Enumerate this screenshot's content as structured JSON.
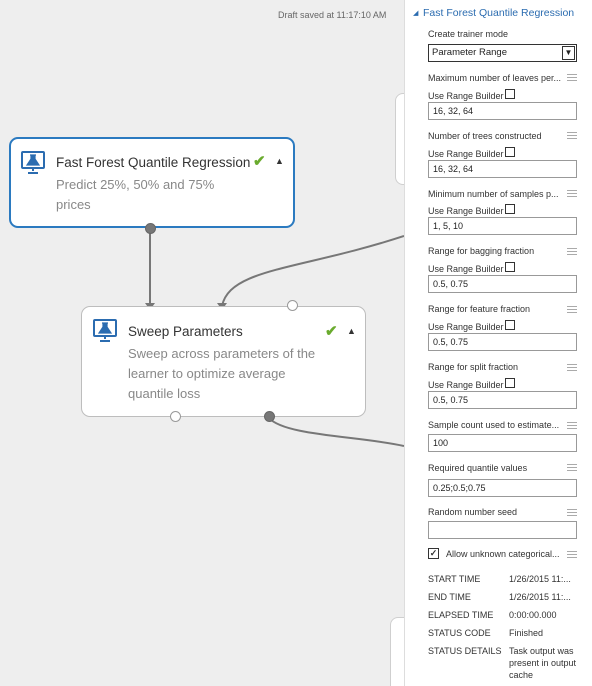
{
  "canvas": {
    "draft_status": "Draft saved at 11:17:10 AM"
  },
  "modules": [
    {
      "title": "Fast Forest Quantile Regression",
      "description": "Predict 25%, 50% and 75% prices",
      "icon": "flask-monitor-icon",
      "status": "check-icon",
      "selected": true
    },
    {
      "title": "Sweep Parameters",
      "description": "Sweep across parameters of the learner to optimize average quantile loss",
      "icon": "flask-monitor-icon",
      "status": "check-icon",
      "selected": false
    }
  ],
  "panel": {
    "title": "Fast Forest Quantile Regression",
    "trainer_mode": {
      "label": "Create trainer mode",
      "value": "Parameter Range"
    },
    "range_builder_label": "Use Range Builder",
    "params": [
      {
        "label": "Maximum number of leaves per...",
        "value": "16, 32, 64",
        "range_builder": false
      },
      {
        "label": "Number of trees constructed",
        "value": "16, 32, 64",
        "range_builder": false
      },
      {
        "label": "Minimum number of samples p...",
        "value": "1, 5, 10",
        "range_builder": false
      },
      {
        "label": "Range for bagging fraction",
        "value": "0.5, 0.75",
        "range_builder": false
      },
      {
        "label": "Range for feature fraction",
        "value": "0.5, 0.75",
        "range_builder": false
      },
      {
        "label": "Range for split fraction",
        "value": "0.5, 0.75",
        "range_builder": false
      }
    ],
    "sample_count": {
      "label": "Sample count used to estimate...",
      "value": "100"
    },
    "quantiles": {
      "label": "Required quantile values",
      "value": "0.25;0.5;0.75"
    },
    "seed": {
      "label": "Random number seed",
      "value": ""
    },
    "allow_unknown": {
      "label": "Allow unknown categorical...",
      "checked": true
    },
    "stats": [
      {
        "key": "START TIME",
        "value": "1/26/2015 11:..."
      },
      {
        "key": "END TIME",
        "value": "1/26/2015 11:..."
      },
      {
        "key": "ELAPSED TIME",
        "value": "0:00:00.000"
      },
      {
        "key": "STATUS CODE",
        "value": "Finished"
      },
      {
        "key": "STATUS DETAILS",
        "value": "Task output was present in output cache"
      }
    ]
  }
}
